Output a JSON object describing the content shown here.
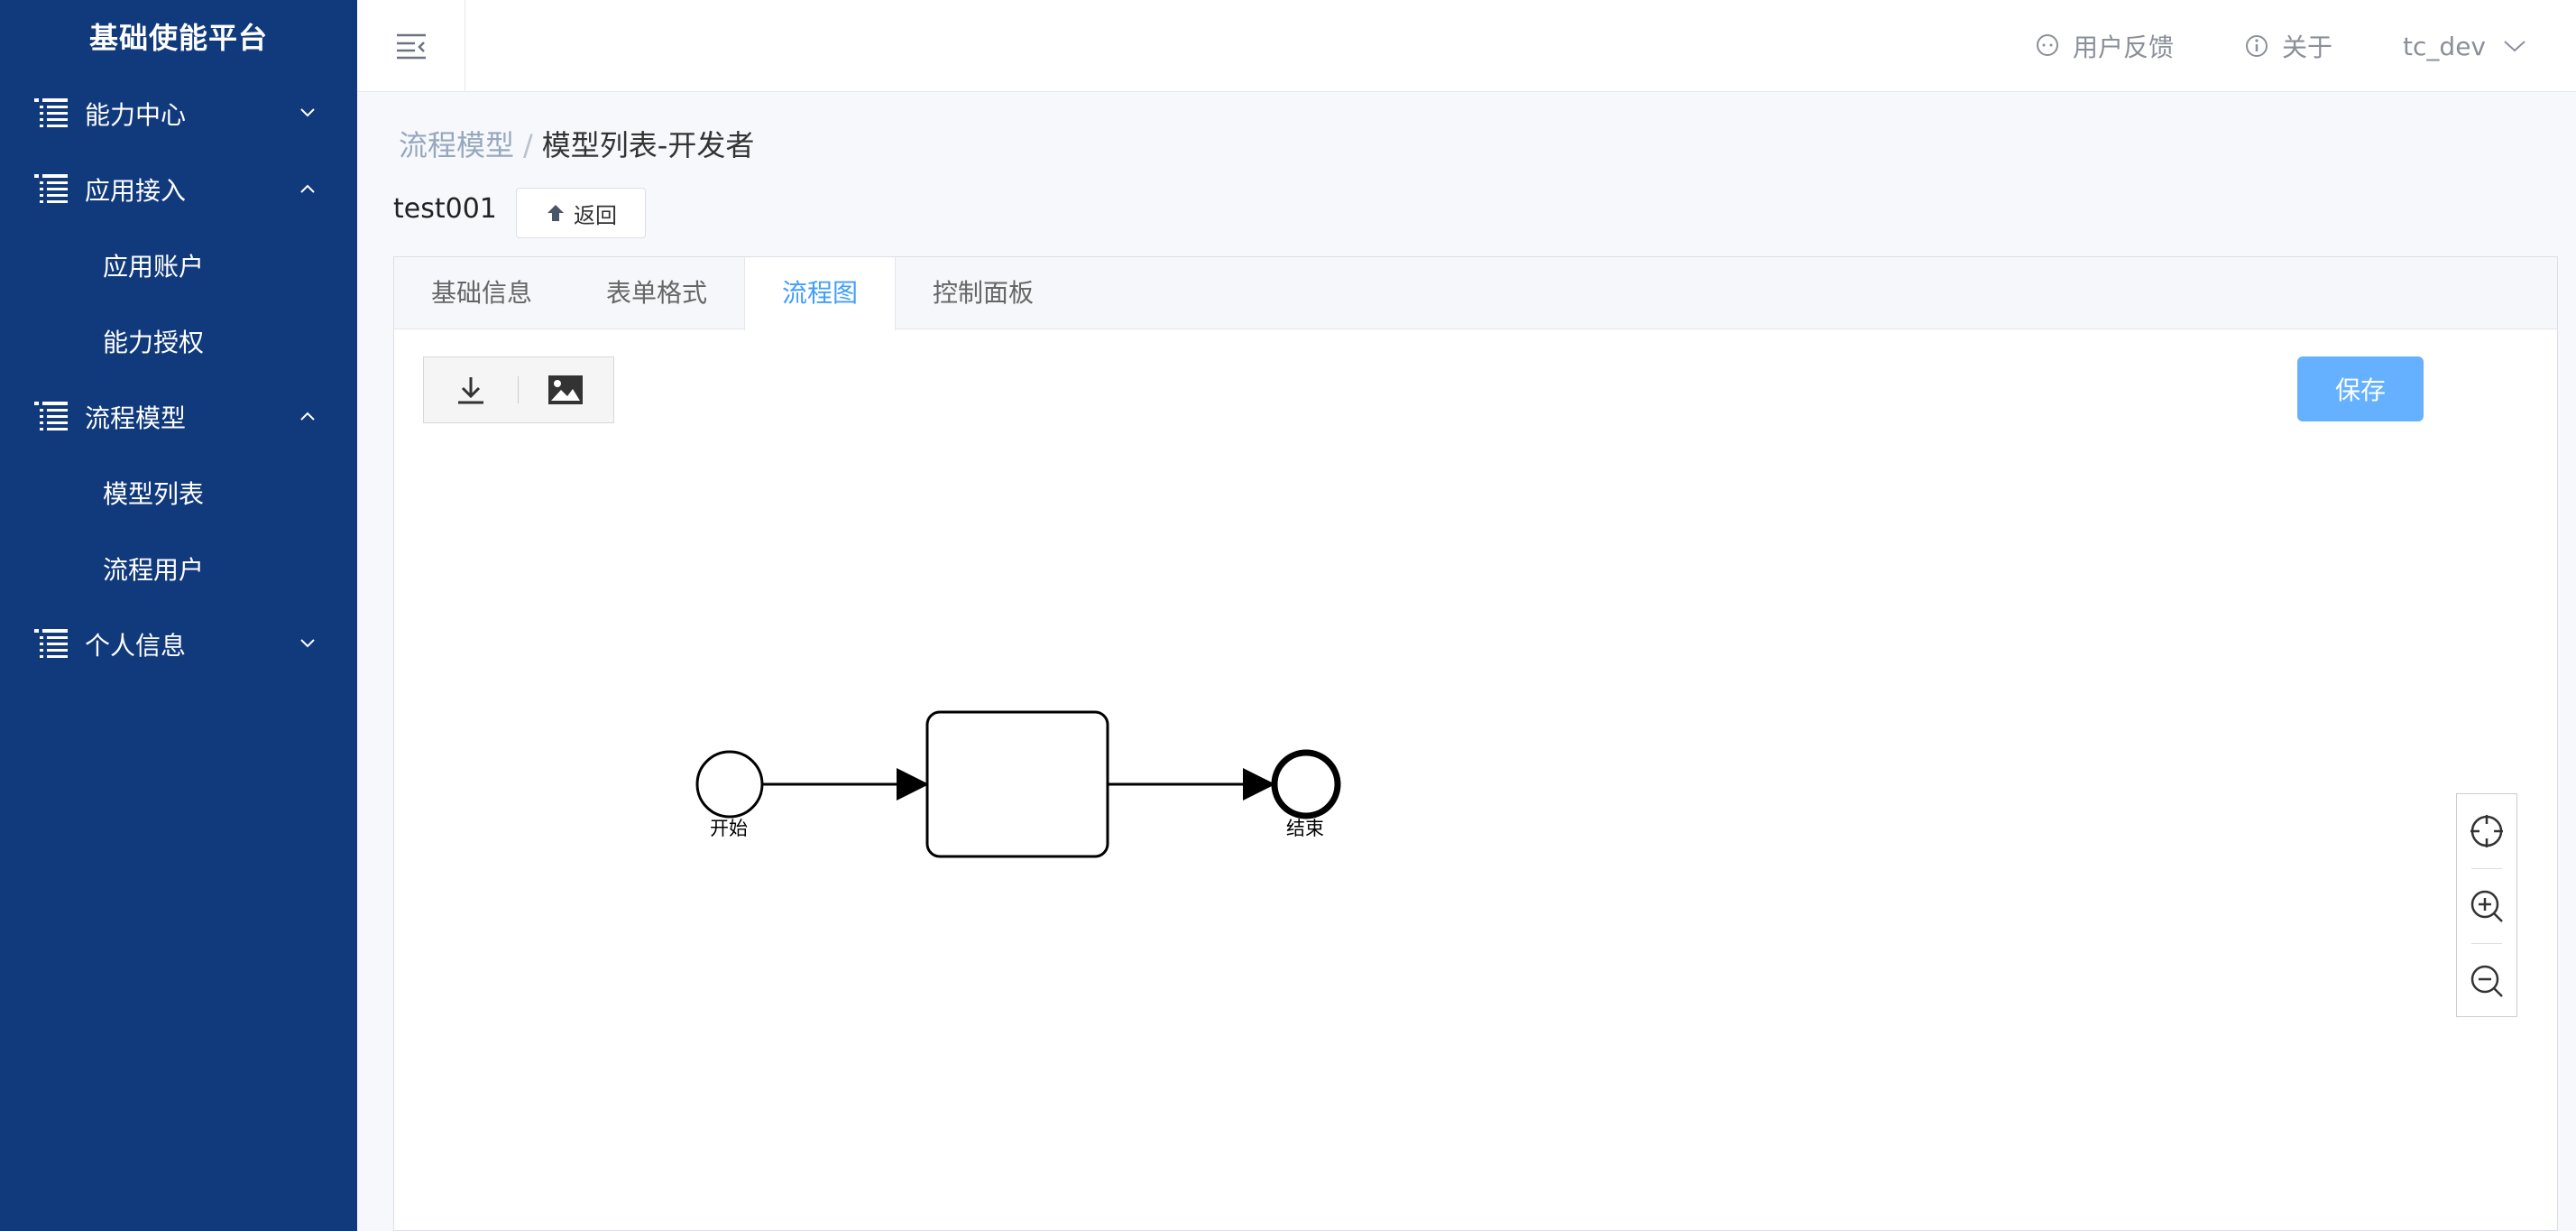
{
  "colors": {
    "sidebar_bg": "#113a7d",
    "primary": "#409eff",
    "save_bg": "#66b1ff"
  },
  "sidebar": {
    "title": "基础使能平台",
    "menu": [
      {
        "label": "能力中心",
        "icon": "list-icon",
        "expanded": false
      },
      {
        "label": "应用接入",
        "icon": "list-icon",
        "expanded": true,
        "children": [
          "应用账户",
          "能力授权"
        ]
      },
      {
        "label": "流程模型",
        "icon": "list-icon",
        "expanded": true,
        "children": [
          "模型列表",
          "流程用户"
        ]
      },
      {
        "label": "个人信息",
        "icon": "list-icon",
        "expanded": false
      }
    ]
  },
  "header": {
    "feedback": "用户反馈",
    "about": "关于",
    "user": "tc_dev"
  },
  "breadcrumb": {
    "parent": "流程模型",
    "separator": "/",
    "current": "模型列表-开发者"
  },
  "model": {
    "name": "test001",
    "back_label": "返回"
  },
  "tabs": [
    {
      "label": "基础信息",
      "active": false
    },
    {
      "label": "表单格式",
      "active": false
    },
    {
      "label": "流程图",
      "active": true
    },
    {
      "label": "控制面板",
      "active": false
    }
  ],
  "toolbar": {
    "download_icon": "download-icon",
    "image_icon": "image-icon",
    "save_label": "保存"
  },
  "diagram": {
    "start_label": "开始",
    "task_label": "",
    "end_label": "结束"
  },
  "zoom": {
    "icons": [
      "crosshair-icon",
      "zoom-in-icon",
      "zoom-out-icon"
    ]
  }
}
